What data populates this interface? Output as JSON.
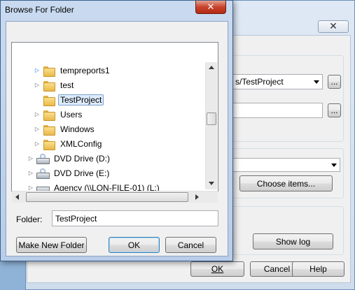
{
  "background_dialog": {
    "close_glyph": "✕",
    "combo1_value": "s/TestProject",
    "browse1_label": "...",
    "browse2_label": "...",
    "choose_items_label": "Choose items...",
    "show_log_label": "Show log",
    "ok_label": "OK",
    "cancel_label": "Cancel",
    "help_label": "Help"
  },
  "dialog": {
    "title": "Browse For Folder",
    "close_glyph": "✕",
    "folder_label": "Folder:",
    "folder_value": "TestProject",
    "make_new_folder_label": "Make New Folder",
    "ok_label": "OK",
    "cancel_label": "Cancel"
  },
  "tree": {
    "items": [
      {
        "label": "tempreports1",
        "icon": "folder-icon",
        "expander": "▷"
      },
      {
        "label": "test",
        "icon": "folder-icon",
        "expander": "▷"
      },
      {
        "label": "TestProject",
        "icon": "folder-icon",
        "expander": "",
        "selected": true
      },
      {
        "label": "Users",
        "icon": "folder-icon",
        "expander": "▷"
      },
      {
        "label": "Windows",
        "icon": "folder-icon",
        "expander": "▷"
      },
      {
        "label": "XMLConfig",
        "icon": "folder-icon",
        "expander": "▷"
      },
      {
        "label": "DVD Drive (D:)",
        "icon": "dvd-drive-icon",
        "expander": "▷"
      },
      {
        "label": "DVD Drive (E:)",
        "icon": "dvd-drive-icon",
        "expander": "▷"
      },
      {
        "label": "Agency (\\\\LON-FILE-01) (L:)",
        "icon": "network-drive-icon",
        "expander": "▷"
      }
    ]
  },
  "colors": {
    "title_bar": "#c9daf0",
    "close_red": "#c7432c",
    "selection_fill": "#dcebfc",
    "selection_border": "#7da2ce"
  }
}
